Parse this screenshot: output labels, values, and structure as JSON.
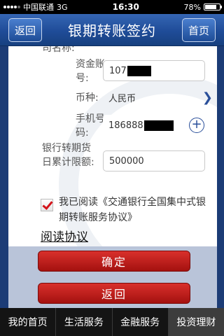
{
  "status_bar": {
    "carrier": "中国联通",
    "network": "3G",
    "time": "16:30",
    "battery": "78%",
    "battery_level": 0.78
  },
  "header": {
    "back_label": "返回",
    "title": "银期转账签约",
    "home_label": "首页"
  },
  "form": {
    "partial_label": "司名称:",
    "account_label": "资金账号:",
    "account_value": "107",
    "currency_label": "币种:",
    "currency_value": "人民币",
    "phone_label": "手机号码:",
    "phone_value": "186888",
    "limit_label_line1": "银行转期货",
    "limit_label_line2": "日累计限额:",
    "limit_value": "500000"
  },
  "agreement": {
    "line1": "我已阅读《交通银行全国集中式银",
    "line2": "期转账服务协议》",
    "checked": true,
    "read_link": "阅读协议"
  },
  "actions": {
    "confirm_label": "确定",
    "back_label": "返回"
  },
  "tabs": [
    {
      "label": "我的首页"
    },
    {
      "label": "生活服务"
    },
    {
      "label": "金融服务"
    },
    {
      "label": "投资理财"
    }
  ]
}
